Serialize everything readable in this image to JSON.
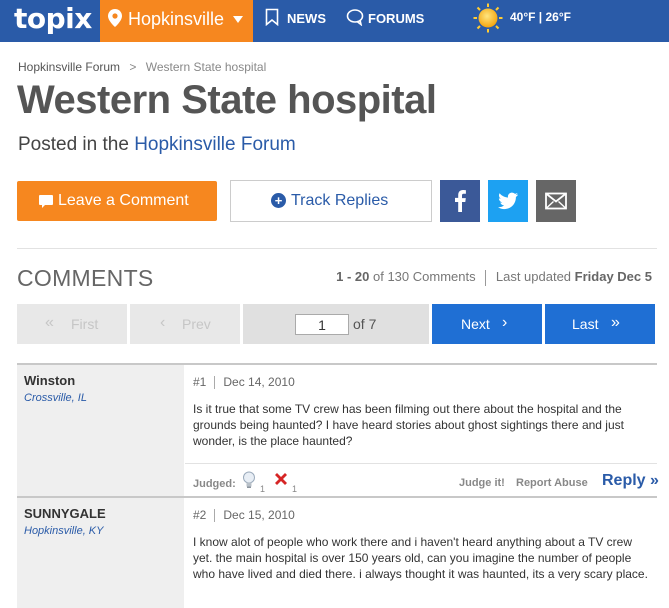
{
  "nav": {
    "logo": "topix",
    "location": "Hopkinsville",
    "news": "NEWS",
    "forums": "FORUMS",
    "weather": "40°F | 26°F",
    "weather_icon": "sun-icon"
  },
  "breadcrumb": {
    "forum": "Hopkinsville Forum",
    "separator": ">",
    "current": "Western State hospital"
  },
  "title": "Western State hospital",
  "posted": {
    "prefix": "Posted in the",
    "forum": "Hopkinsville Forum"
  },
  "actions": {
    "leave_comment": "Leave a Comment",
    "track_replies": "Track Replies",
    "social_icons": [
      "facebook-icon",
      "twitter-icon",
      "email-icon"
    ]
  },
  "comments_header": {
    "title": "COMMENTS",
    "range": "1 - 20",
    "of_text": "of 130 Comments",
    "updated_label": "Last updated",
    "updated_value": "Friday Dec 5"
  },
  "pagination": {
    "first": "First",
    "prev": "Prev",
    "current_page": "1",
    "of_pages": "of 7",
    "next": "Next",
    "last": "Last"
  },
  "comments": [
    {
      "author": "Winston",
      "location": "Crossville, IL",
      "number": "#1",
      "date": "Dec 14, 2010",
      "body": "Is it true that some TV crew has been filming out there about the hospital and the grounds being haunted? I have heard stories about ghost sightings there and just wonder, is the place haunted?",
      "judged_label": "Judged:",
      "judge_positive": "1",
      "judge_negative": "1",
      "judge_it": "Judge it!",
      "report_abuse": "Report Abuse",
      "reply": "Reply »"
    },
    {
      "author": "SUNNYGALE",
      "location": "Hopkinsville, KY",
      "number": "#2",
      "date": "Dec 15, 2010",
      "body": "I know alot of people who work there and i haven't heard anything about a TV crew yet. the main hospital is over 150 years old, can you imagine the number of people who have lived and died there. i always thought it was haunted, its a very scary place."
    }
  ],
  "colors": {
    "nav_blue": "#2a5ba8",
    "orange": "#f6871f",
    "pager_blue": "#1f6fd4"
  }
}
